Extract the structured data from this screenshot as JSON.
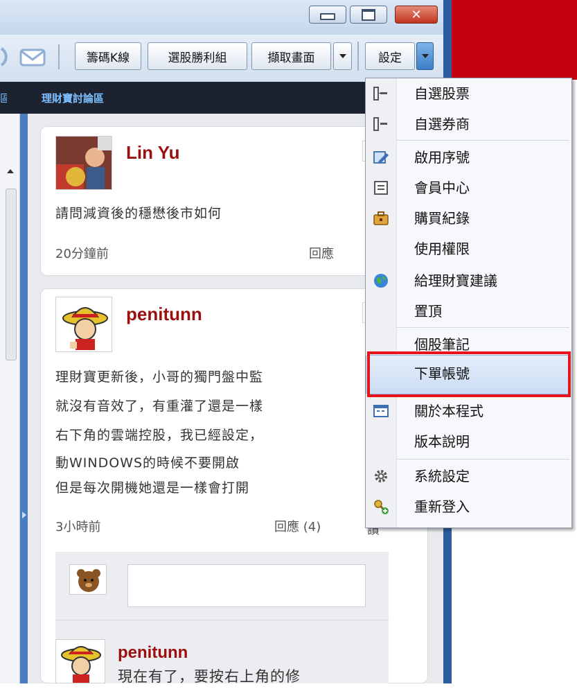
{
  "toolbar": {
    "kline_label": "籌碼K線",
    "combo_label": "選股勝利組",
    "capture_label": "擷取畫面",
    "settings_label": "設定"
  },
  "window_buttons": {
    "close": "✕"
  },
  "forum": {
    "title": "理財寶討論區"
  },
  "posts": [
    {
      "author": "Lin Yu",
      "text": "請問減資後的穩懋後市如何",
      "time": "20分鐘前",
      "reply": "回應"
    },
    {
      "author": "penitunn",
      "lines": [
        "理財寶更新後，小哥的獨門盤中監",
        "就沒有音效了，有重灌了還是一樣",
        "右下角的雲端控股，我已經設定，",
        "動WINDOWS的時候不要開啟",
        "但是每次開機她還是一樣會打開"
      ],
      "time": "3小時前",
      "reply": "回應 (4)",
      "extra": "讚"
    }
  ],
  "comment": {
    "author": "penitunn",
    "text": "現在有了，要按右上角的修"
  },
  "menu": {
    "items": [
      {
        "label": "自選股票",
        "icon": "list-icon"
      },
      {
        "label": "自選券商",
        "icon": "list-icon"
      },
      {
        "label": "啟用序號",
        "icon": "edit-icon"
      },
      {
        "label": "會員中心",
        "icon": "document-icon"
      },
      {
        "label": "購買紀錄",
        "icon": "briefcase-icon"
      },
      {
        "label": "使用權限",
        "icon": ""
      },
      {
        "label": "給理財寶建議",
        "icon": "globe-icon"
      },
      {
        "label": "置頂",
        "icon": ""
      },
      {
        "label": "個股筆記",
        "icon": ""
      },
      {
        "label": "下單帳號",
        "icon": ""
      },
      {
        "label": "關於本程式",
        "icon": "window-icon"
      },
      {
        "label": "版本說明",
        "icon": ""
      },
      {
        "label": "系統設定",
        "icon": "gear-icon"
      },
      {
        "label": "重新登入",
        "icon": "key-icon"
      }
    ],
    "highlighted": "下單帳號"
  },
  "colors": {
    "accent_red": "#c40010",
    "highlight_box": "#e8141c",
    "author": "#9a0f0f",
    "forum_title": "#7ec0ff"
  }
}
